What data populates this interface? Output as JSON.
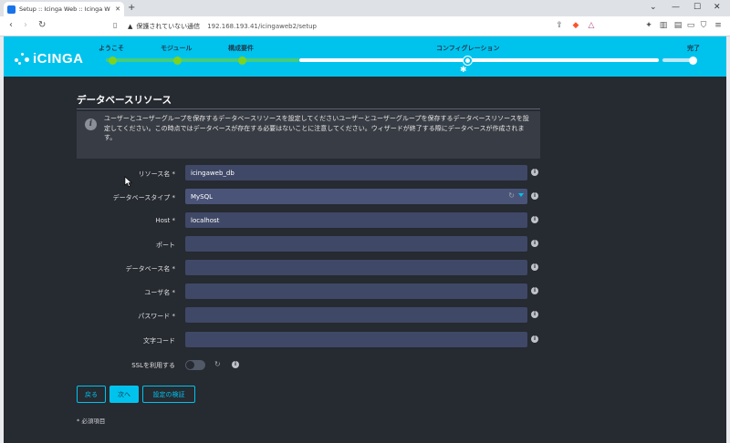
{
  "browser": {
    "tab_title": "Setup :: Icinga Web :: Icinga W",
    "tab_close": "✕",
    "new_tab": "+",
    "security_warning": "保護されていない通信",
    "url": "192.168.193.41/icingaweb2/setup",
    "window_controls": [
      "⌄",
      "—",
      "☐",
      "✕"
    ]
  },
  "app": {
    "logo_text": "iCINGA",
    "steps": [
      {
        "label": "ようこそ",
        "status": "done"
      },
      {
        "label": "モジュール",
        "status": "done"
      },
      {
        "label": "構成要件",
        "status": "done"
      },
      {
        "label": "コンフィグレーション",
        "status": "current"
      },
      {
        "label": "完了",
        "status": "pending"
      }
    ],
    "page_title": "データベースリソース",
    "info_text": "ユーザーとユーザーグループを保存するデータベースリソースを設定してくださいユーザーとユーザーグループを保存するデータベースリソースを設定してください。この時点ではデータベースが存在する必要はないことに注意してください。ウィザードが終了する際にデータベースが作成されます。",
    "fields": [
      {
        "label": "リソース名 *",
        "value": "icingaweb_db"
      },
      {
        "label": "データベースタイプ *",
        "value": "MySQL"
      },
      {
        "label": "Host *",
        "value": "localhost"
      },
      {
        "label": "ポート",
        "value": ""
      },
      {
        "label": "データベース名 *",
        "value": ""
      },
      {
        "label": "ユーザ名 *",
        "value": ""
      },
      {
        "label": "パスワード *",
        "value": ""
      },
      {
        "label": "文字コード",
        "value": ""
      }
    ],
    "ssl_label": "SSLを利用する",
    "ssl_enabled": false,
    "buttons": {
      "back": "戻る",
      "next": "次へ",
      "validate": "設定の検証"
    },
    "required_note": "* 必須項目",
    "colors": {
      "accent": "#00c3ed",
      "progress_done": "#7ed321",
      "background": "#262a31",
      "input": "#3f4866"
    }
  }
}
